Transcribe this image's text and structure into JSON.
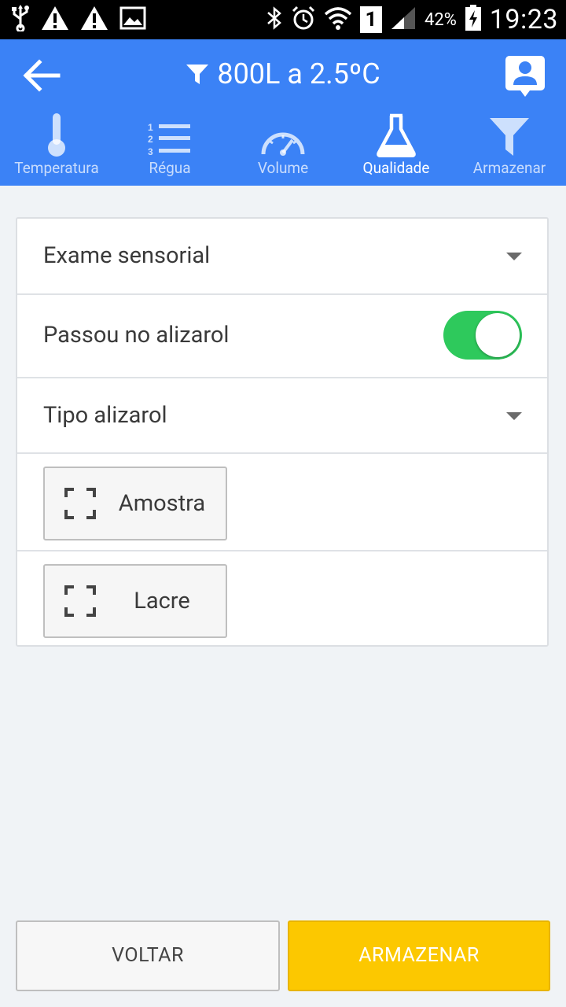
{
  "status_bar": {
    "battery_percent": "42%",
    "time": "19:23",
    "sim_slot": "1"
  },
  "header": {
    "title": "800L a 2.5ºC",
    "color": "#3b82f6"
  },
  "tabs": [
    {
      "label": "Temperatura",
      "icon": "thermometer-icon",
      "active": false
    },
    {
      "label": "Régua",
      "icon": "numbered-list-icon",
      "active": false
    },
    {
      "label": "Volume",
      "icon": "gauge-icon",
      "active": false
    },
    {
      "label": "Qualidade",
      "icon": "flask-icon",
      "active": true
    },
    {
      "label": "Armazenar",
      "icon": "funnel-icon",
      "active": false
    }
  ],
  "form": {
    "sensory_exam": {
      "label": "Exame sensorial"
    },
    "alizarol_passed": {
      "label": "Passou no alizarol",
      "value": true
    },
    "alizarol_type": {
      "label": "Tipo alizarol"
    },
    "sample_button": {
      "label": "Amostra"
    },
    "seal_button": {
      "label": "Lacre"
    }
  },
  "footer": {
    "back_label": "VOLTAR",
    "store_label": "ARMAZENAR",
    "store_color": "#fcc800"
  }
}
